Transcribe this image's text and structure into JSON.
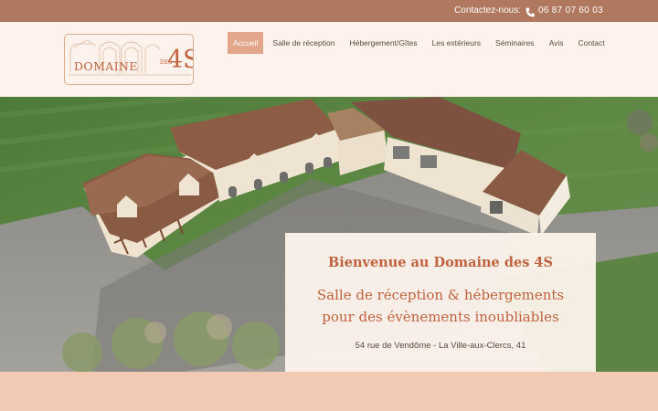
{
  "topbar": {
    "contact_label": "Contactez-nous:",
    "phone": "06 87 07 60 03",
    "phone_icon": "phone-icon"
  },
  "logo": {
    "brand": "DOMAINE",
    "des": "DES",
    "num": "4S"
  },
  "nav": {
    "items": [
      {
        "label": "Accueil",
        "active": true
      },
      {
        "label": "Salle de réception"
      },
      {
        "label": "Hébergement/Gîtes"
      },
      {
        "label": "Les extérieurs"
      },
      {
        "label": "Séminaires"
      },
      {
        "label": "Avis"
      },
      {
        "label": "Contact"
      }
    ]
  },
  "welcome": {
    "title": "Bienvenue au Domaine des 4S",
    "subtitle_line1": "Salle de réception & hébergements",
    "subtitle_line2": "pour des évènements inoubliables",
    "address": "54 rue de Vendôme - La Ville-aux-Clercs, 41"
  },
  "colors": {
    "topbar": "#b0785e",
    "accent": "#c0623e",
    "nav_active": "#e2a68a",
    "header_bg": "#fdf3ec",
    "footer_band": "#f2c9b3"
  }
}
